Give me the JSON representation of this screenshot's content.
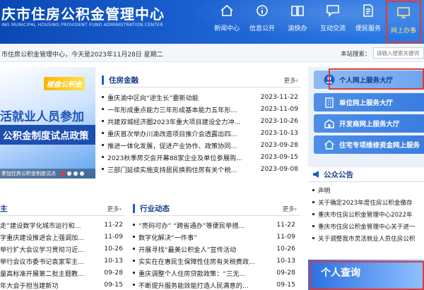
{
  "header": {
    "title": "庆市住房公积金管理中心",
    "subtitle": "ING MUNICIPAL HOUSING PROVIDENT FUND ADMINISTRATION CENTER",
    "nav": [
      {
        "label": "新闻中心",
        "icon": "home-icon"
      },
      {
        "label": "信息公开",
        "icon": "info-icon"
      },
      {
        "label": "渝快办",
        "icon": "book-icon"
      },
      {
        "label": "互动交流",
        "icon": "chat-icon"
      },
      {
        "label": "便民服务",
        "icon": "document-icon"
      },
      {
        "label": "网上办事",
        "icon": "monitor-icon"
      }
    ]
  },
  "info": {
    "welcome": "市住房公积金管理中心，今天是2023年11月28日 星期二",
    "search_label": "本站搜索：",
    "search_placeholder": "请输入搜索关键词"
  },
  "banner": {
    "tag": "楼盘公积金",
    "line1": "活就业人员参加",
    "line2": "公积金制度试点政策",
    "caption": "参加住房公积金制度试点"
  },
  "housing_finance": {
    "title": "住房金融",
    "more": "更多›",
    "items": [
      {
        "title": "重庆渝中区向“逆生长”要新动能",
        "date": "2023-11-22"
      },
      {
        "title": "一年形成重点能力三年形成基本能力五年形...",
        "date": "2023-11-09"
      },
      {
        "title": "共建双城经济圈2023年重大项目建设全力冲...",
        "date": "2023-10-26"
      },
      {
        "title": "重庆首次举办川渝改造项目推介会透露出四...",
        "date": "2023-10-13"
      },
      {
        "title": "推进一体化发展，促进产业协作、政策协同...",
        "date": "2023-09-28"
      },
      {
        "title": "2023秋季房交会开幕88家企业及单位参展购...",
        "date": "2023-09-15"
      },
      {
        "title": "三部门延续实施支持居民换购住房有关个税...",
        "date": "2023-09-08"
      }
    ]
  },
  "left_news": {
    "title": "主",
    "more": "更多›",
    "items": [
      {
        "title": "走”建设数字化城市运行和...",
        "date": "11-22"
      },
      {
        "title": "字重庆建设推进会上强调加...",
        "date": "11-09"
      },
      {
        "title": "举行扩大会议学习贯彻习近...",
        "date": "10-26"
      },
      {
        "title": "举行会议市委书记袁家军主...",
        "date": "10-13"
      },
      {
        "title": "量高标准开展第二批主题教...",
        "date": "09-28"
      },
      {
        "title": "年大会于担当建新功",
        "date": "09-15"
      }
    ]
  },
  "industry_news": {
    "title": "行业动态",
    "more": "更多›",
    "items": [
      {
        "title": "“亮码可办” “跨省通办”等便民举措...",
        "date": "11-22"
      },
      {
        "title": "数字化解决“一件事”",
        "date": "11-09"
      },
      {
        "title": "开展寻找“最美公积金人”宣传活动",
        "date": "10-26"
      },
      {
        "title": "实实在在惠民生保障性住房有关税费政...",
        "date": "10-13"
      },
      {
        "title": "重庆调整个人住房贷款政策：“三无...",
        "date": "09-28"
      },
      {
        "title": "不断提升服务能效能打造人民满意的...",
        "date": "09-15"
      }
    ]
  },
  "services": [
    {
      "label": "个人网上服务大厅",
      "icon": "user-icon"
    },
    {
      "label": "单位网上服务大厅",
      "icon": "building-icon"
    },
    {
      "label": "开发商网上服务大厅",
      "icon": "developer-icon"
    },
    {
      "label": "住宅专项维修资金网上服务",
      "icon": "house-icon"
    }
  ],
  "notices": {
    "title": "公众公告",
    "items": [
      "声明",
      "关于确定2023年度住房公积金缴存",
      "重庆市住房公积金管理中心2022年",
      "重庆市住房公积金管理中心关于进一",
      "关于调整我市灵活就业人员住房公积"
    ]
  },
  "query": {
    "label": "个人查询"
  },
  "colors": {
    "brand": "#1a5fd0",
    "highlight": "#e53935"
  }
}
